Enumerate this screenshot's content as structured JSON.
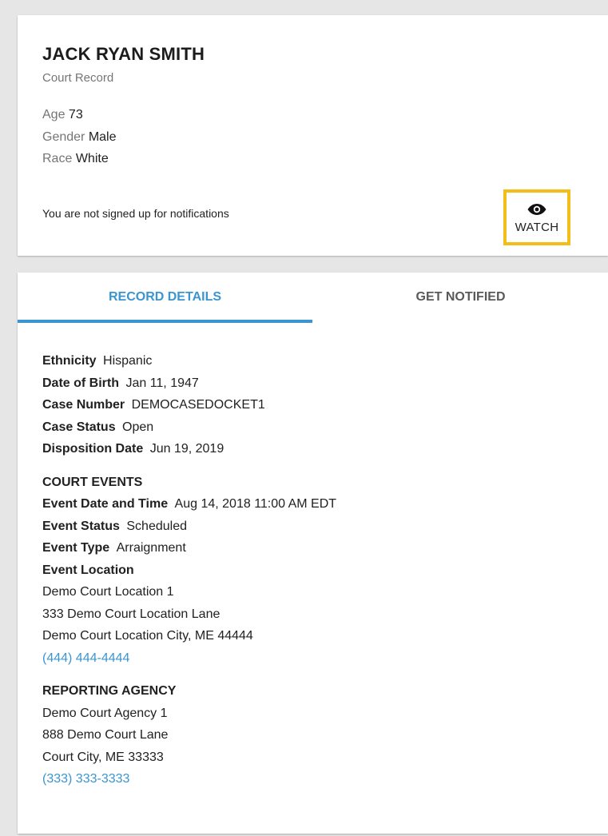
{
  "header": {
    "name": "JACK RYAN SMITH",
    "subtitle": "Court Record",
    "age_label": "Age",
    "age": "73",
    "gender_label": "Gender",
    "gender": "Male",
    "race_label": "Race",
    "race": "White",
    "notification_status": "You are not signed up for notifications",
    "watch_label": "WATCH"
  },
  "tabs": [
    {
      "label": "RECORD DETAILS",
      "active": true
    },
    {
      "label": "GET NOTIFIED",
      "active": false
    }
  ],
  "details": {
    "ethnicity_label": "Ethnicity",
    "ethnicity": "Hispanic",
    "dob_label": "Date of Birth",
    "dob": "Jan 11, 1947",
    "case_number_label": "Case Number",
    "case_number": "DEMOCASEDOCKET1",
    "case_status_label": "Case Status",
    "case_status": "Open",
    "disposition_label": "Disposition Date",
    "disposition_date": "Jun 19, 2019"
  },
  "court_events": {
    "title": "COURT EVENTS",
    "event_datetime_label": "Event Date and Time",
    "event_datetime": "Aug 14, 2018 11:00 AM EDT",
    "event_status_label": "Event Status",
    "event_status": "Scheduled",
    "event_type_label": "Event Type",
    "event_type": "Arraignment",
    "event_location_label": "Event Location",
    "location_line1": "Demo Court Location 1",
    "location_line2": "333 Demo Court Location Lane",
    "location_line3": "Demo Court Location City, ME 44444",
    "phone": "(444) 444-4444"
  },
  "reporting_agency": {
    "title": "REPORTING AGENCY",
    "line1": "Demo Court Agency 1",
    "line2": "888 Demo Court Lane",
    "line3": "Court City, ME 33333",
    "phone": "(333) 333-3333"
  },
  "colors": {
    "accent": "#3a95d1",
    "highlight": "#f5bd1a",
    "background": "#e6e6e6"
  },
  "icons": {
    "watch": "eye-icon"
  }
}
